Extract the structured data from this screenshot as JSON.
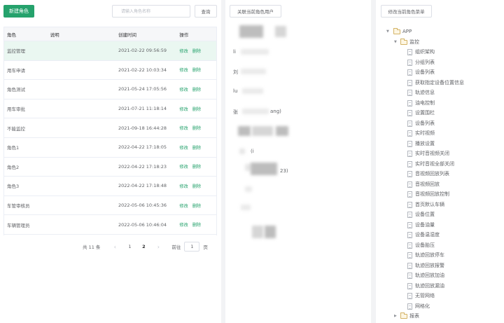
{
  "roles_panel": {
    "new_button": "新建角色",
    "search_placeholder": "请输入角色名称",
    "search_button": "查询",
    "columns": [
      "角色",
      "说明",
      "创建时间",
      "操作"
    ],
    "rows": [
      {
        "name": "监控管理",
        "desc": "",
        "created": "2021-02-22 09:56:59",
        "edit": "修改",
        "delete": "删除",
        "selected": true
      },
      {
        "name": "用车申请",
        "desc": "",
        "created": "2021-02-22 10:03:34",
        "edit": "修改",
        "delete": "删除"
      },
      {
        "name": "角色测试",
        "desc": "",
        "created": "2021-05-24 17:05:56",
        "edit": "修改",
        "delete": "删除"
      },
      {
        "name": "用车审批",
        "desc": "",
        "created": "2021-07-21 11:18:14",
        "edit": "修改",
        "delete": "删除"
      },
      {
        "name": "不能监控",
        "desc": "",
        "created": "2021-09-18 16:44:28",
        "edit": "修改",
        "delete": "删除"
      },
      {
        "name": "角色1",
        "desc": "",
        "created": "2022-04-22 17:18:05",
        "edit": "修改",
        "delete": "删除"
      },
      {
        "name": "角色2",
        "desc": "",
        "created": "2022-04-22 17:18:23",
        "edit": "修改",
        "delete": "删除"
      },
      {
        "name": "角色3",
        "desc": "",
        "created": "2022-04-22 17:18:48",
        "edit": "修改",
        "delete": "删除"
      },
      {
        "name": "车管审核员",
        "desc": "",
        "created": "2022-05-06 10:45:36",
        "edit": "修改",
        "delete": "删除"
      },
      {
        "name": "车辆管理员",
        "desc": "",
        "created": "2022-05-06 10:46:04",
        "edit": "修改",
        "delete": "删除"
      }
    ],
    "pagination": {
      "total": "共 11 条",
      "prev_icon": "chevron-left-icon",
      "next_icon": "chevron-right-icon",
      "pages": [
        "1",
        "2"
      ],
      "current_page": "2",
      "goto_prefix": "前往",
      "goto_value": "1",
      "goto_suffix": "页"
    }
  },
  "users_panel": {
    "button": "关联当前角色用户",
    "visible_fragments": [
      "li",
      "刘",
      "lu",
      "张",
      "ang)",
      "(i",
      "23)"
    ]
  },
  "menu_panel": {
    "button": "修改当前角色菜单",
    "tree": {
      "root": "APP",
      "group": "监控",
      "items": [
        "组织架构",
        "分组列表",
        "设备列表",
        "获取指定设备位置信息",
        "轨迹信息",
        "油电控制",
        "设置围栏",
        "设备列表",
        "实时视频",
        "播放设置",
        "实时音视频关闭",
        "实时音视全部关闭",
        "音视频回放列表",
        "音视频回放",
        "音视频回放控制",
        "首页默认车辆",
        "设备位置",
        "设备油量",
        "设备温湿度",
        "设备胎压",
        "轨迹回放停车",
        "轨迹回放报警",
        "轨迹回放加油",
        "轨迹回放漏油",
        "无管网络",
        "网格化"
      ],
      "last_group": "报表"
    }
  }
}
